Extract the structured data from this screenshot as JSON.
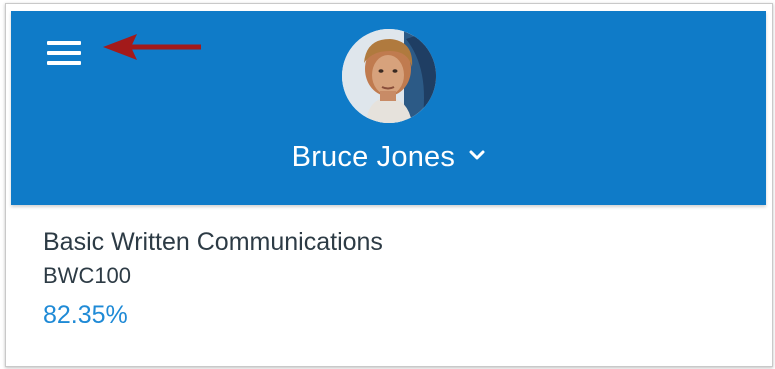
{
  "header": {
    "menu_icon": "hamburger-menu-icon",
    "annotation_icon": "red-arrow-left-icon",
    "avatar_icon": "user-avatar-photo",
    "user_name": "Bruce Jones",
    "dropdown_icon": "chevron-down-icon",
    "background_color": "#0F7BC8",
    "arrow_color": "#A31A1A"
  },
  "course": {
    "name": "Basic Written Communications",
    "code": "BWC100",
    "grade": "82.35%",
    "grade_color": "#1F8AD6"
  }
}
